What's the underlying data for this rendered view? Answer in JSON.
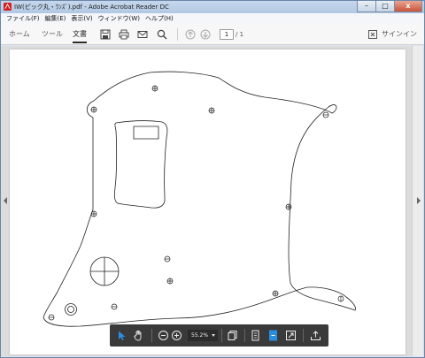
{
  "window": {
    "title": "IW(ピック丸・ﾜﾝｽﾞ).pdf - Adobe Acrobat Reader DC",
    "minimize_label": "–",
    "maximize_label": "□",
    "close_label": "x"
  },
  "menu": {
    "items": [
      {
        "label": "ファイル(F)"
      },
      {
        "label": "編集(E)"
      },
      {
        "label": "表示(V)"
      },
      {
        "label": "ウィンドウ(W)"
      },
      {
        "label": "ヘルプ(H)"
      }
    ]
  },
  "toolbar": {
    "tabs": [
      {
        "label": "ホーム"
      },
      {
        "label": "ツール"
      },
      {
        "label": "文書"
      }
    ],
    "page_current": "1",
    "page_total": "/ 1",
    "signin_label": "サインイン"
  },
  "floating_toolbar": {
    "zoom_value": "55.2%"
  },
  "colors": {
    "title_bar": "#b8cce4",
    "toolbar_bg": "#f7f7f7",
    "doc_bg": "#dcdcdc",
    "floating_toolbar_bg": "#3a3a3a",
    "accent": "#2a8ee0"
  }
}
